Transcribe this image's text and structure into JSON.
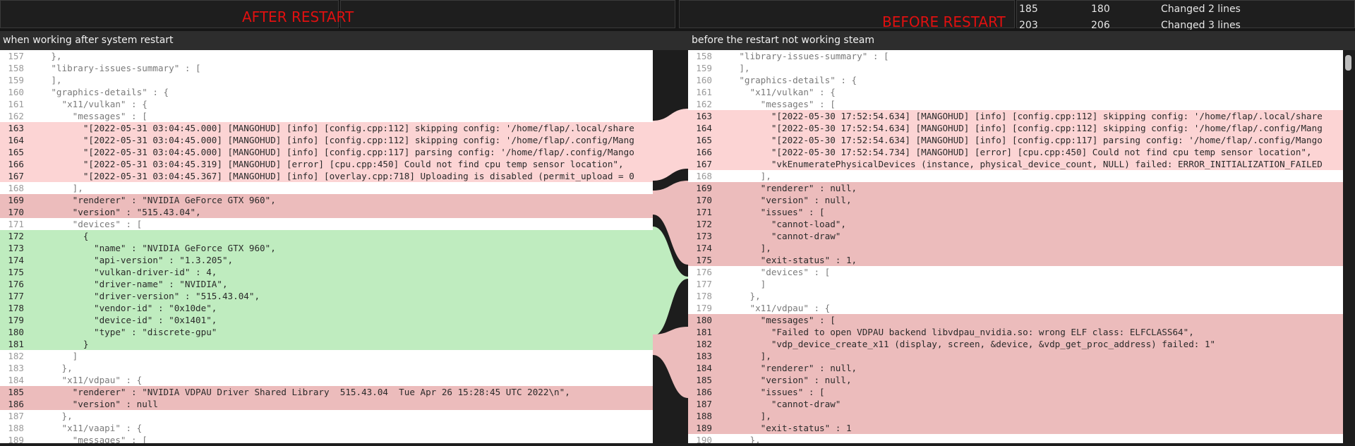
{
  "top": {
    "after_label": "AFTER RESTART",
    "before_label": "BEFORE RESTART",
    "changes": [
      {
        "a": "185",
        "b": "180",
        "desc": "Changed 2 lines"
      },
      {
        "a": "203",
        "b": "206",
        "desc": "Changed 3 lines"
      }
    ]
  },
  "left_title": "when working after system restart",
  "right_title": "before the restart not working steam",
  "left_lines": [
    {
      "n": "157",
      "t": "    },",
      "k": "eq"
    },
    {
      "n": "158",
      "t": "    \"library-issues-summary\" : [",
      "k": "eq"
    },
    {
      "n": "159",
      "t": "    ],",
      "k": "eq"
    },
    {
      "n": "160",
      "t": "    \"graphics-details\" : {",
      "k": "eq"
    },
    {
      "n": "161",
      "t": "      \"x11/vulkan\" : {",
      "k": "eq"
    },
    {
      "n": "162",
      "t": "        \"messages\" : [",
      "k": "eq"
    },
    {
      "n": "163",
      "t": "          \"[2022-05-31 03:04:45.000] [MANGOHUD] [info] [config.cpp:112] skipping config: '/home/flap/.local/share",
      "k": "chg1"
    },
    {
      "n": "164",
      "t": "          \"[2022-05-31 03:04:45.000] [MANGOHUD] [info] [config.cpp:112] skipping config: '/home/flap/.config/Mang",
      "k": "chg1"
    },
    {
      "n": "165",
      "t": "          \"[2022-05-31 03:04:45.000] [MANGOHUD] [info] [config.cpp:117] parsing config: '/home/flap/.config/Mango",
      "k": "chg1"
    },
    {
      "n": "166",
      "t": "          \"[2022-05-31 03:04:45.319] [MANGOHUD] [error] [cpu.cpp:450] Could not find cpu temp sensor location\",",
      "k": "chg1"
    },
    {
      "n": "167",
      "t": "          \"[2022-05-31 03:04:45.367] [MANGOHUD] [info] [overlay.cpp:718] Uploading is disabled (permit_upload = 0",
      "k": "chg1"
    },
    {
      "n": "168",
      "t": "        ],",
      "k": "eq"
    },
    {
      "n": "169",
      "t": "        \"renderer\" : \"NVIDIA GeForce GTX 960\",",
      "k": "chg2"
    },
    {
      "n": "170",
      "t": "        \"version\" : \"515.43.04\",",
      "k": "chg2"
    },
    {
      "n": "171",
      "t": "        \"devices\" : [",
      "k": "eq"
    },
    {
      "n": "172",
      "t": "          {",
      "k": "add"
    },
    {
      "n": "173",
      "t": "            \"name\" : \"NVIDIA GeForce GTX 960\",",
      "k": "add"
    },
    {
      "n": "174",
      "t": "            \"api-version\" : \"1.3.205\",",
      "k": "add"
    },
    {
      "n": "175",
      "t": "            \"vulkan-driver-id\" : 4,",
      "k": "add"
    },
    {
      "n": "176",
      "t": "            \"driver-name\" : \"NVIDIA\",",
      "k": "add"
    },
    {
      "n": "177",
      "t": "            \"driver-version\" : \"515.43.04\",",
      "k": "add"
    },
    {
      "n": "178",
      "t": "            \"vendor-id\" : \"0x10de\",",
      "k": "add"
    },
    {
      "n": "179",
      "t": "            \"device-id\" : \"0x1401\",",
      "k": "add"
    },
    {
      "n": "180",
      "t": "            \"type\" : \"discrete-gpu\"",
      "k": "add"
    },
    {
      "n": "181",
      "t": "          }",
      "k": "add"
    },
    {
      "n": "182",
      "t": "        ]",
      "k": "eq"
    },
    {
      "n": "183",
      "t": "      },",
      "k": "eq"
    },
    {
      "n": "184",
      "t": "      \"x11/vdpau\" : {",
      "k": "eq"
    },
    {
      "n": "185",
      "t": "        \"renderer\" : \"NVIDIA VDPAU Driver Shared Library  515.43.04  Tue Apr 26 15:28:45 UTC 2022\\n\",",
      "k": "chg2"
    },
    {
      "n": "186",
      "t": "        \"version\" : null",
      "k": "chg2"
    },
    {
      "n": "187",
      "t": "      },",
      "k": "eq"
    },
    {
      "n": "188",
      "t": "      \"x11/vaapi\" : {",
      "k": "eq"
    },
    {
      "n": "189",
      "t": "        \"messages\" : [",
      "k": "eq"
    }
  ],
  "right_lines": [
    {
      "n": "158",
      "t": "    \"library-issues-summary\" : [",
      "k": "eq"
    },
    {
      "n": "159",
      "t": "    ],",
      "k": "eq"
    },
    {
      "n": "160",
      "t": "    \"graphics-details\" : {",
      "k": "eq"
    },
    {
      "n": "161",
      "t": "      \"x11/vulkan\" : {",
      "k": "eq"
    },
    {
      "n": "162",
      "t": "        \"messages\" : [",
      "k": "eq"
    },
    {
      "n": "163",
      "t": "          \"[2022-05-30 17:52:54.634] [MANGOHUD] [info] [config.cpp:112] skipping config: '/home/flap/.local/share",
      "k": "chg1"
    },
    {
      "n": "164",
      "t": "          \"[2022-05-30 17:52:54.634] [MANGOHUD] [info] [config.cpp:112] skipping config: '/home/flap/.config/Mang",
      "k": "chg1"
    },
    {
      "n": "165",
      "t": "          \"[2022-05-30 17:52:54.634] [MANGOHUD] [info] [config.cpp:117] parsing config: '/home/flap/.config/Mango",
      "k": "chg1"
    },
    {
      "n": "166",
      "t": "          \"[2022-05-30 17:52:54.734] [MANGOHUD] [error] [cpu.cpp:450] Could not find cpu temp sensor location\",",
      "k": "chg1"
    },
    {
      "n": "167",
      "t": "          \"vkEnumeratePhysicalDevices (instance, physical_device_count, NULL) failed: ERROR_INITIALIZATION_FAILED",
      "k": "chg1"
    },
    {
      "n": "168",
      "t": "        ],",
      "k": "eq"
    },
    {
      "n": "169",
      "t": "        \"renderer\" : null,",
      "k": "chg2"
    },
    {
      "n": "170",
      "t": "        \"version\" : null,",
      "k": "chg2"
    },
    {
      "n": "171",
      "t": "        \"issues\" : [",
      "k": "chg2"
    },
    {
      "n": "172",
      "t": "          \"cannot-load\",",
      "k": "chg2"
    },
    {
      "n": "173",
      "t": "          \"cannot-draw\"",
      "k": "chg2"
    },
    {
      "n": "174",
      "t": "        ],",
      "k": "chg2"
    },
    {
      "n": "175",
      "t": "        \"exit-status\" : 1,",
      "k": "chg2"
    },
    {
      "n": "176",
      "t": "        \"devices\" : [",
      "k": "eq"
    },
    {
      "n": "177",
      "t": "        ]",
      "k": "eq"
    },
    {
      "n": "178",
      "t": "      },",
      "k": "eq"
    },
    {
      "n": "179",
      "t": "      \"x11/vdpau\" : {",
      "k": "eq"
    },
    {
      "n": "180",
      "t": "        \"messages\" : [",
      "k": "chg2"
    },
    {
      "n": "181",
      "t": "          \"Failed to open VDPAU backend libvdpau_nvidia.so: wrong ELF class: ELFCLASS64\",",
      "k": "chg2"
    },
    {
      "n": "182",
      "t": "          \"vdp_device_create_x11 (display, screen, &device, &vdp_get_proc_address) failed: 1\"",
      "k": "chg2"
    },
    {
      "n": "183",
      "t": "        ],",
      "k": "chg2"
    },
    {
      "n": "184",
      "t": "        \"renderer\" : null,",
      "k": "chg2"
    },
    {
      "n": "185",
      "t": "        \"version\" : null,",
      "k": "chg2"
    },
    {
      "n": "186",
      "t": "        \"issues\" : [",
      "k": "chg2"
    },
    {
      "n": "187",
      "t": "          \"cannot-draw\"",
      "k": "chg2"
    },
    {
      "n": "188",
      "t": "        ],",
      "k": "chg2"
    },
    {
      "n": "189",
      "t": "        \"exit-status\" : 1",
      "k": "chg2"
    },
    {
      "n": "190",
      "t": "      },",
      "k": "eq"
    }
  ],
  "colors": {
    "changed_light": "#fcd4d4",
    "changed_dark": "#ecbcbc",
    "added": "#bfecbf",
    "title_red": "#e01010"
  }
}
